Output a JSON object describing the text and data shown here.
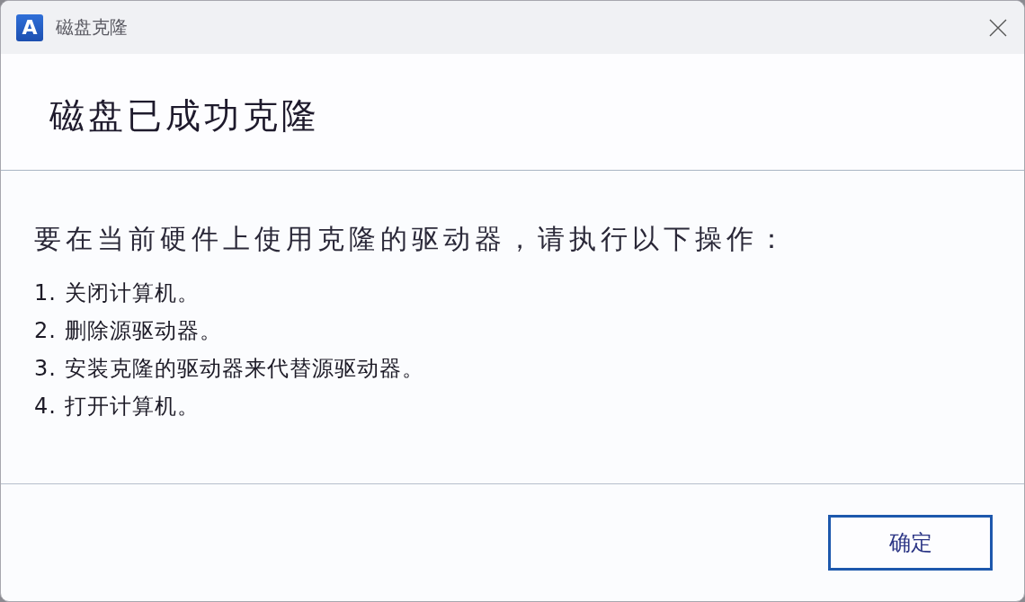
{
  "window": {
    "title": "磁盘克隆",
    "app_icon_letter": "A"
  },
  "header": {
    "heading": "磁盘已成功克隆"
  },
  "content": {
    "intro": "要在当前硬件上使用克隆的驱动器，请执行以下操作：",
    "steps": [
      "1. 关闭计算机。",
      "2. 删除源驱动器。",
      "3. 安装克隆的驱动器来代替源驱动器。",
      "4. 打开计算机。"
    ]
  },
  "buttons": [
    {
      "label": "确定",
      "default": true
    }
  ]
}
